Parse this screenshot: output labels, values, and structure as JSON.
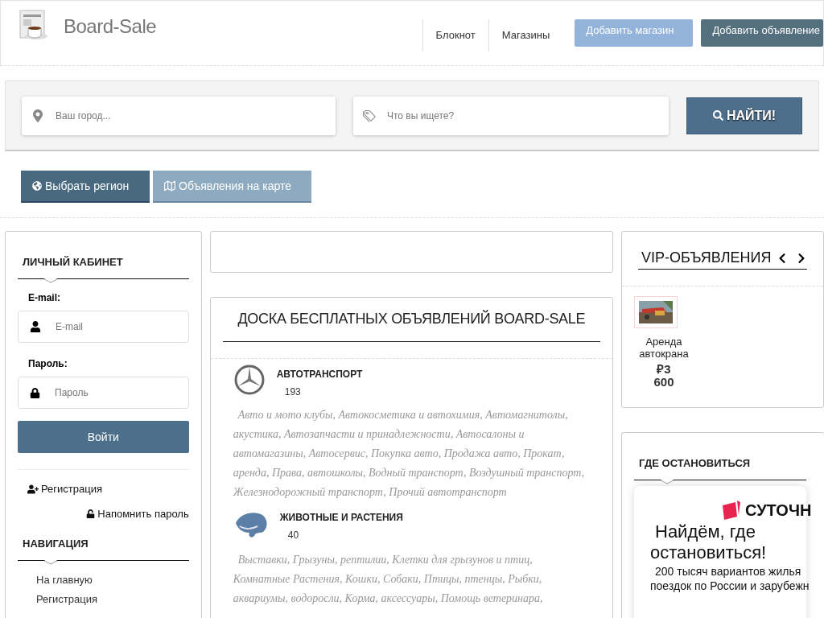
{
  "header": {
    "site_name": "Board-Sale",
    "nav": [
      {
        "label": "Блокнот"
      },
      {
        "label": "Магазины"
      }
    ],
    "buttons": [
      {
        "label": "Добавить магазин",
        "kind": "light"
      },
      {
        "label": "Добавить объявление",
        "kind": "dark"
      }
    ]
  },
  "search": {
    "city_placeholder": "Ваш город...",
    "query_placeholder": "Что вы ищете?",
    "button": "НАЙТИ!"
  },
  "actions": [
    {
      "label": "Выбрать регион",
      "kind": "globe"
    },
    {
      "label": "Объявления на карте",
      "kind": "map"
    }
  ],
  "login": {
    "title": "ЛИЧНЫЙ КАБИНЕТ",
    "email_label": "E-mail:",
    "email_placeholder": "E-mail",
    "password_label": "Пароль:",
    "password_placeholder": "Пароль",
    "submit": "Войти",
    "register": "Регистрация",
    "remind": "Напомнить пароль"
  },
  "navigation": {
    "title": "НАВИГАЦИЯ",
    "items": [
      "На главную",
      "Регистрация"
    ]
  },
  "board": {
    "title": "ДОСКА БЕСПЛАТНЫХ ОБЪЯВЛЕНИЙ BOARD-SALE",
    "categories": [
      {
        "kind": "car",
        "name": "АВТОТРАНСПОРТ",
        "count": "193",
        "subcategories": "Авто и мото клубы, Автокосметика и автохимия, Автомагнитолы, акустика, Автозапчасти и принадлежности, Автосалоны и автомагазины, Автосервис, Покупка авто, Продажа авто, Прокат, аренда, Права, автошколы, Водный транспорт, Воздушный транспорт, Железнодорожный транспорт, Прочий автотранспорт"
      },
      {
        "kind": "animal",
        "name": "ЖИВОТНЫЕ И РАСТЕНИЯ",
        "count": "40",
        "subcategories": "Выставки, Грызуны, рептилии, Клетки для грызунов и птиц, Комнатные Растения, Кошки, Собаки, Птицы, птенцы, Рыбки, аквариумы, водоросли, Корма, аксессуары, Помощь ветеринара,"
      }
    ]
  },
  "vip": {
    "title": "VIP-ОБЪЯВЛЕНИЯ",
    "items": [
      {
        "kind": "picture",
        "title": "Аренда автокрана",
        "price": "₽3 600"
      }
    ]
  },
  "stay": {
    "title": "ГДЕ ОСТАНОВИТЬСЯ",
    "brand": "СУТОЧН",
    "headline": "Найдём, где остановиться!",
    "text_lines": [
      "200 тысяч вариантов жилья",
      "поездок по России и зарубежн"
    ]
  }
}
